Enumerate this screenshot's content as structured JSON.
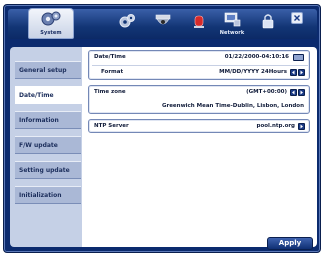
{
  "toolbar": {
    "system_label": "System",
    "network_label": "Network"
  },
  "sidebar": {
    "items": [
      {
        "label": "General setup"
      },
      {
        "label": "Date/Time"
      },
      {
        "label": "Information"
      },
      {
        "label": "F/W update"
      },
      {
        "label": "Setting update"
      },
      {
        "label": "Initialization"
      }
    ]
  },
  "datetime": {
    "date_time_label": "Date/Time",
    "date_time_value": "01/22/2000-04:10:16",
    "format_label": "Format",
    "format_value": "MM/DD/YYYY 24Hours"
  },
  "timezone": {
    "label": "Time zone",
    "offset": "(GMT+00:00)",
    "name": "Greenwich Mean Time-Dublin, Lisbon, London"
  },
  "ntp": {
    "label": "NTP Server",
    "value": "pool.ntp.org"
  },
  "buttons": {
    "apply": "Apply"
  },
  "colors": {
    "frame": "#0b2a6e",
    "sidebar": "#c5d0e6",
    "button": "#1b3a86"
  }
}
